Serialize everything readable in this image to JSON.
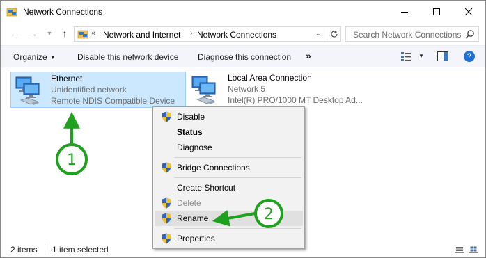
{
  "window": {
    "title": "Network Connections"
  },
  "address": {
    "overflow": "«",
    "crumbs": [
      "Network and Internet",
      "Network Connections"
    ],
    "separator": "›"
  },
  "search": {
    "placeholder": "Search Network Connections"
  },
  "toolbar": {
    "organize": "Organize",
    "disable": "Disable this network device",
    "diagnose": "Diagnose this connection",
    "more": "»",
    "help": "?"
  },
  "items": [
    {
      "name": "Ethernet",
      "status": "Unidentified network",
      "device": "Remote NDIS Compatible Device",
      "selected": true
    },
    {
      "name": "Local Area Connection",
      "status": "Network  5",
      "device": "Intel(R) PRO/1000 MT Desktop Ad...",
      "selected": false
    }
  ],
  "context_menu": {
    "items": [
      {
        "label": "Disable",
        "shield": true,
        "bold": false,
        "disabled": false
      },
      {
        "label": "Status",
        "shield": false,
        "bold": true,
        "disabled": false
      },
      {
        "label": "Diagnose",
        "shield": false,
        "bold": false,
        "disabled": false
      },
      {
        "label": "Bridge Connections",
        "shield": true,
        "bold": false,
        "disabled": false
      },
      {
        "label": "Create Shortcut",
        "shield": false,
        "bold": false,
        "disabled": false
      },
      {
        "label": "Delete",
        "shield": true,
        "bold": false,
        "disabled": true
      },
      {
        "label": "Rename",
        "shield": true,
        "bold": false,
        "disabled": false,
        "highlighted": true
      },
      {
        "label": "Properties",
        "shield": true,
        "bold": false,
        "disabled": false
      }
    ]
  },
  "status_bar": {
    "count": "2 items",
    "selected": "1 item selected"
  },
  "annotations": {
    "step1": "1",
    "step2": "2",
    "color": "#1fa01f"
  },
  "colors": {
    "selection_bg": "#cce8ff",
    "selection_border": "#99d1ff",
    "toolbar_bg": "#f3f5fa",
    "help_blue": "#1e6fd9"
  }
}
